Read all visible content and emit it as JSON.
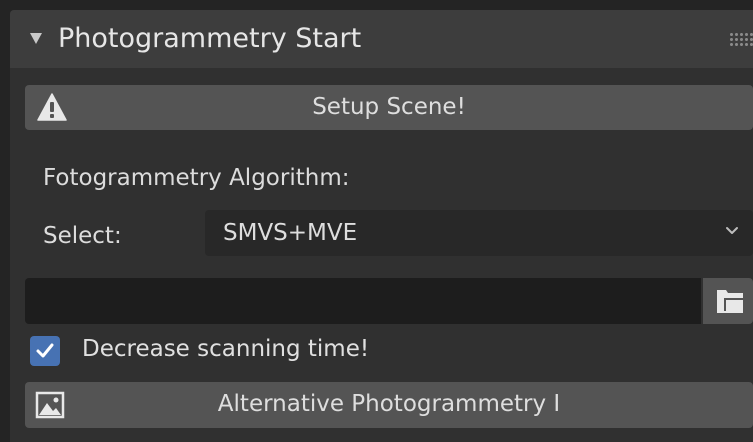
{
  "panel": {
    "title": "Photogrammetry Start",
    "collapse_icon": "triangle-down-icon",
    "grip_icon": "drag-grip-icon"
  },
  "setup_button": {
    "label": "Setup Scene!",
    "icon": "warning-icon"
  },
  "algorithm": {
    "heading": "Fotogrammetry Algorithm:",
    "select_label": "Select:",
    "selected_value": "SMVS+MVE",
    "dropdown_icon": "chevron-down-icon"
  },
  "path_field": {
    "value": "",
    "browse_icon": "folder-icon"
  },
  "decrease_time": {
    "label": "Decrease scanning time!",
    "checked": true
  },
  "alternative_button": {
    "label": "Alternative Photogrammetry I",
    "icon": "image-icon"
  },
  "colors": {
    "panel_bg": "#303030",
    "header_bg": "#3d3d3d",
    "button_bg": "#545454",
    "field_bg": "#1d1d1d",
    "accent": "#4772b3"
  }
}
